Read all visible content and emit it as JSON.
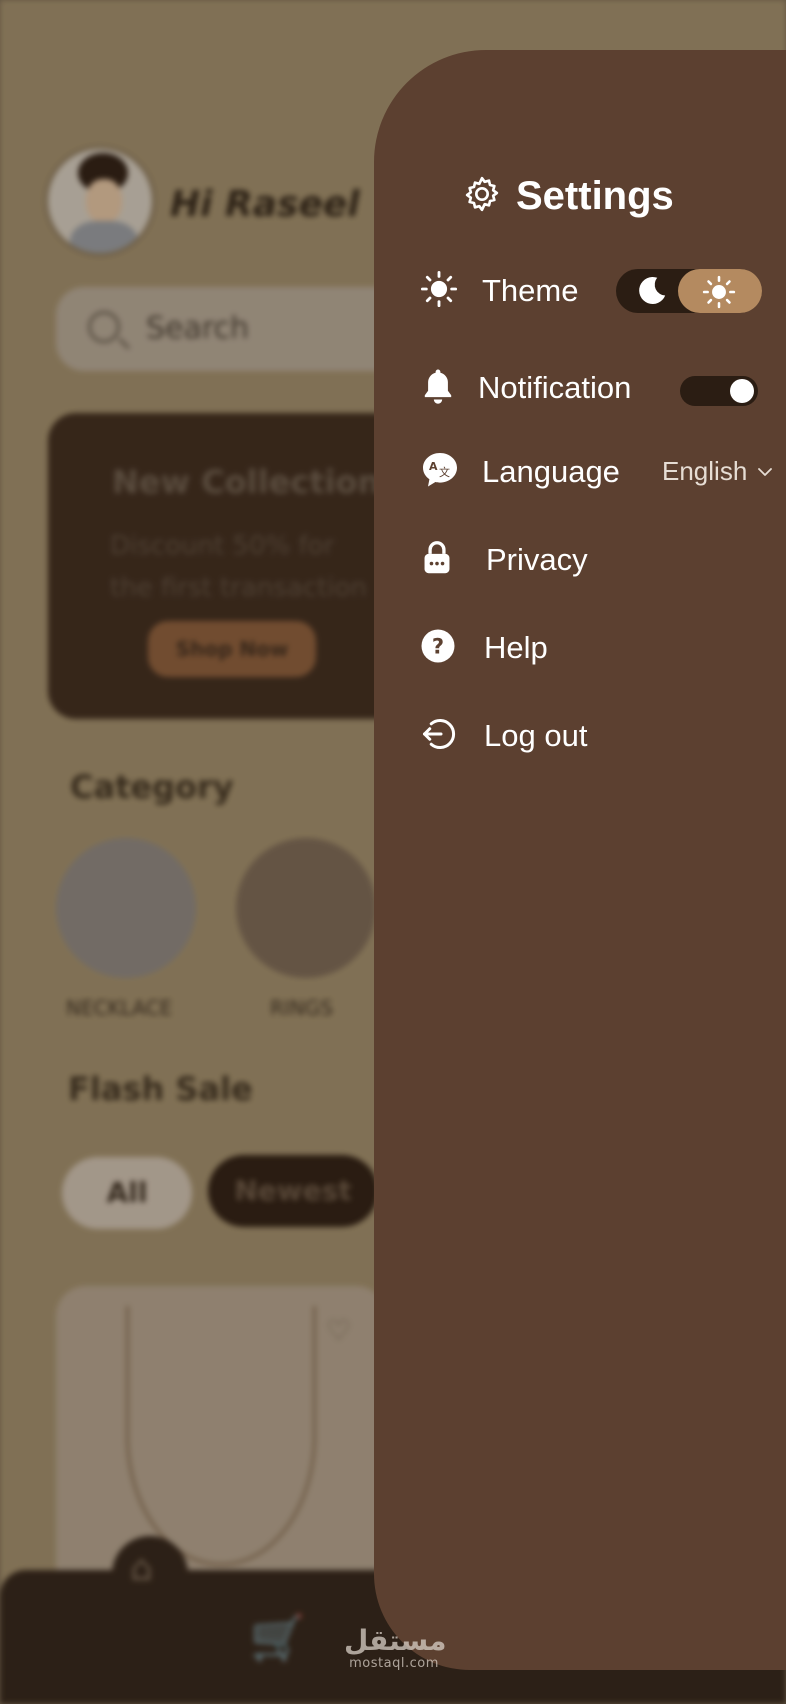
{
  "background": {
    "greeting": "Hi Raseel",
    "search_placeholder": "Search",
    "banner": {
      "title": "New Collection",
      "line1": "Discount 50% for",
      "line2": "the first transaction",
      "button": "Shop Now"
    },
    "category_heading": "Category",
    "categories": [
      "NECKLACE",
      "RINGS"
    ],
    "flash_sale_heading": "Flash Sale",
    "filters": [
      "All",
      "Newest"
    ]
  },
  "settings": {
    "title": "Settings",
    "theme_label": "Theme",
    "notification_label": "Notification",
    "notification_on": true,
    "language_label": "Language",
    "language_value": "English",
    "privacy_label": "Privacy",
    "help_label": "Help",
    "logout_label": "Log out",
    "theme_selected": "light"
  },
  "watermark": {
    "arabic": "مستقل",
    "latin": "mostaql.com"
  },
  "colors": {
    "drawer": "#5c4030",
    "toggle_track": "#2b1d13",
    "toggle_accent": "#b48a60"
  }
}
